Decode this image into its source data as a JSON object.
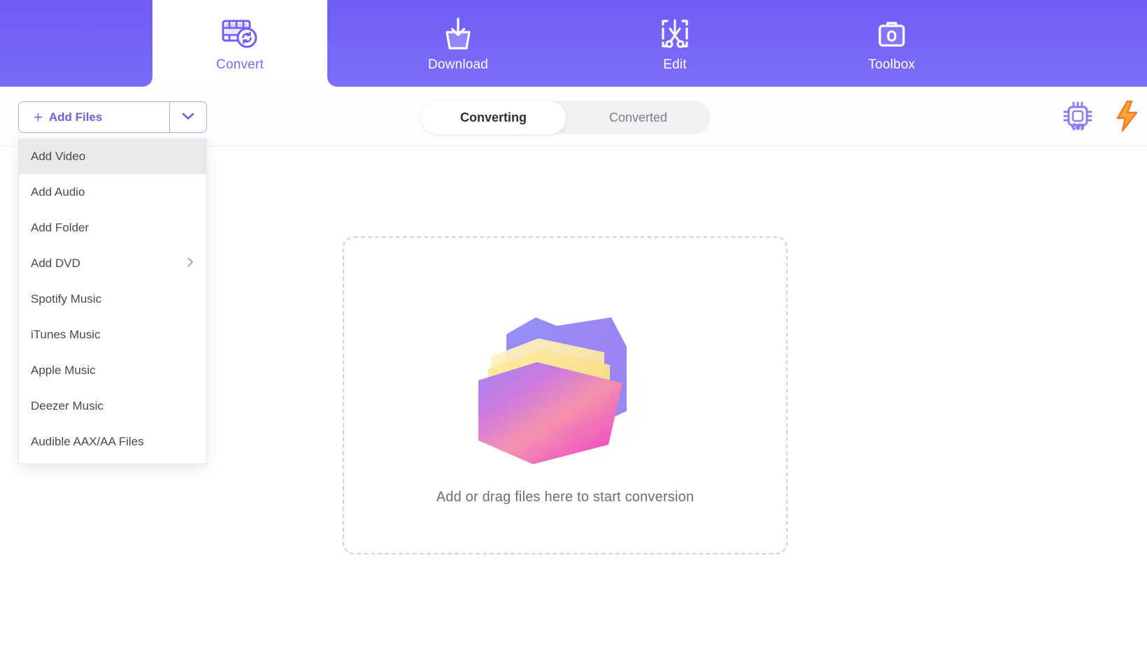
{
  "nav": {
    "tabs": [
      {
        "id": "convert",
        "label": "Convert",
        "icon": "film-convert-icon",
        "active": true
      },
      {
        "id": "download",
        "label": "Download",
        "icon": "download-tray-icon",
        "active": false
      },
      {
        "id": "edit",
        "label": "Edit",
        "icon": "scissors-crop-icon",
        "active": false
      },
      {
        "id": "toolbox",
        "label": "Toolbox",
        "icon": "toolbox-icon",
        "active": false
      }
    ],
    "accent_purple": "#6f5df5",
    "active_tab_text": "#7a6bf0"
  },
  "toolbar": {
    "add_files": {
      "label": "Add Files",
      "plus_icon": "plus-icon",
      "caret_icon": "chevron-down-icon"
    },
    "segments": [
      {
        "id": "converting",
        "label": "Converting",
        "active": true
      },
      {
        "id": "converted",
        "label": "Converted",
        "active": false
      }
    ],
    "right_icons": [
      {
        "id": "gpu-acceleration",
        "icon": "chip-icon",
        "badge": "on"
      },
      {
        "id": "high-speed",
        "icon": "lightning-icon",
        "badge": ""
      }
    ]
  },
  "dropdown": {
    "open": true,
    "items": [
      {
        "label": "Add Video",
        "highlight": true,
        "submenu": false
      },
      {
        "label": "Add Audio",
        "highlight": false,
        "submenu": false
      },
      {
        "label": "Add Folder",
        "highlight": false,
        "submenu": false
      },
      {
        "label": "Add DVD",
        "highlight": false,
        "submenu": true
      },
      {
        "label": "Spotify Music",
        "highlight": false,
        "submenu": false
      },
      {
        "label": "iTunes Music",
        "highlight": false,
        "submenu": false
      },
      {
        "label": "Apple Music",
        "highlight": false,
        "submenu": false
      },
      {
        "label": "Deezer Music",
        "highlight": false,
        "submenu": false
      },
      {
        "label": "Audible AAX/AA Files",
        "highlight": false,
        "submenu": false
      }
    ],
    "submenu_arrow": "chevron-right-icon"
  },
  "dropzone": {
    "message": "Add or drag files here to start conversion",
    "illustration": "folder-files-icon",
    "border_color": "#d3d3d8"
  }
}
